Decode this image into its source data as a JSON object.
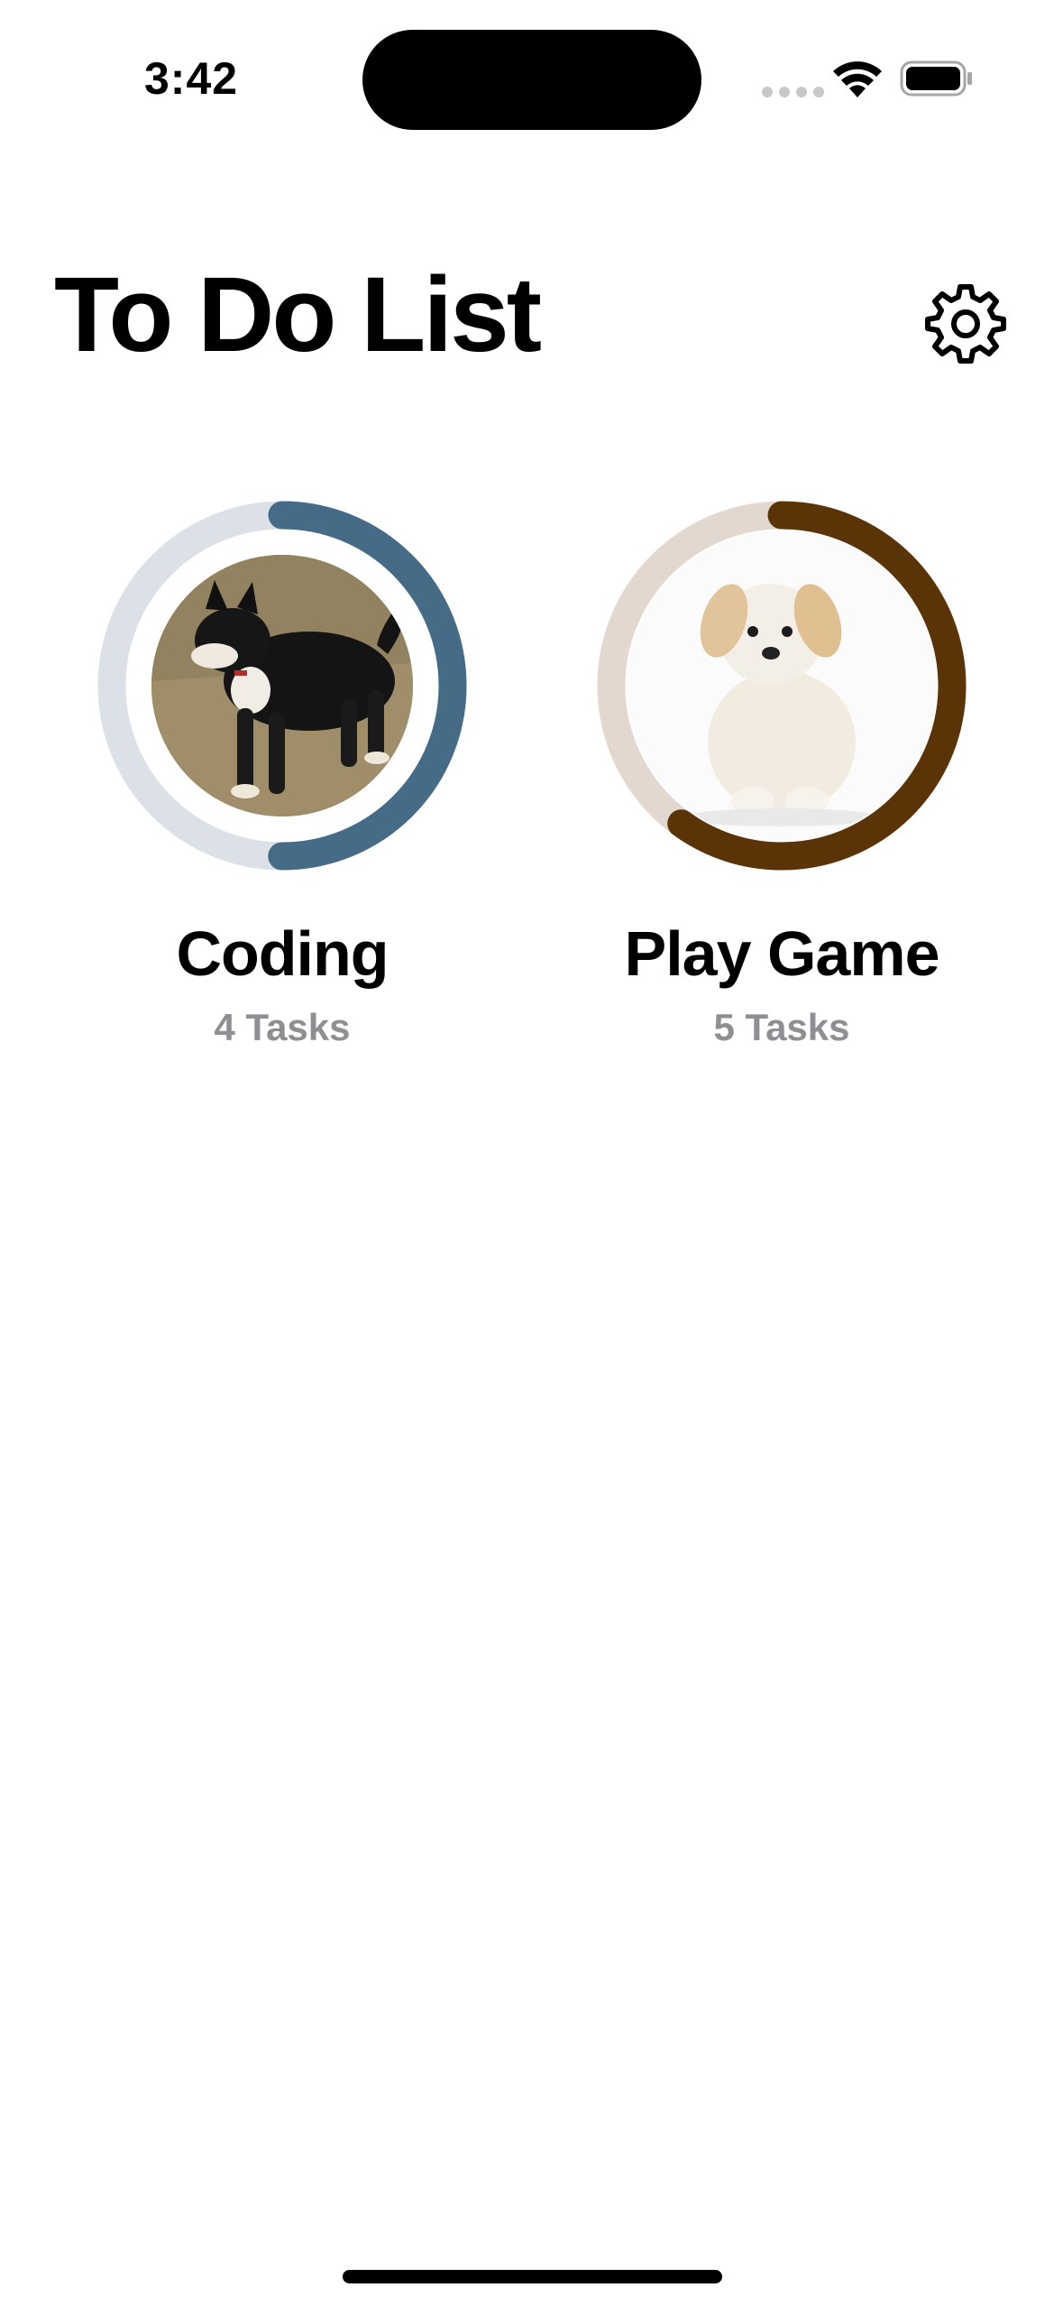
{
  "status_bar": {
    "time": "3:42"
  },
  "header": {
    "title": "To Do List",
    "settings_icon": "gear-icon"
  },
  "categories": [
    {
      "title": "Coding",
      "subtitle": "4 Tasks",
      "progress": 0.5,
      "ring_color": "#456b87",
      "track_color": "#dbe1e7",
      "image": "black and tan dog standing on grass"
    },
    {
      "title": "Play Game",
      "subtitle": "5 Tasks",
      "progress": 0.6,
      "ring_color": "#5a3407",
      "track_color": "#e3d8cf",
      "image": "cream puppy sitting"
    }
  ]
}
